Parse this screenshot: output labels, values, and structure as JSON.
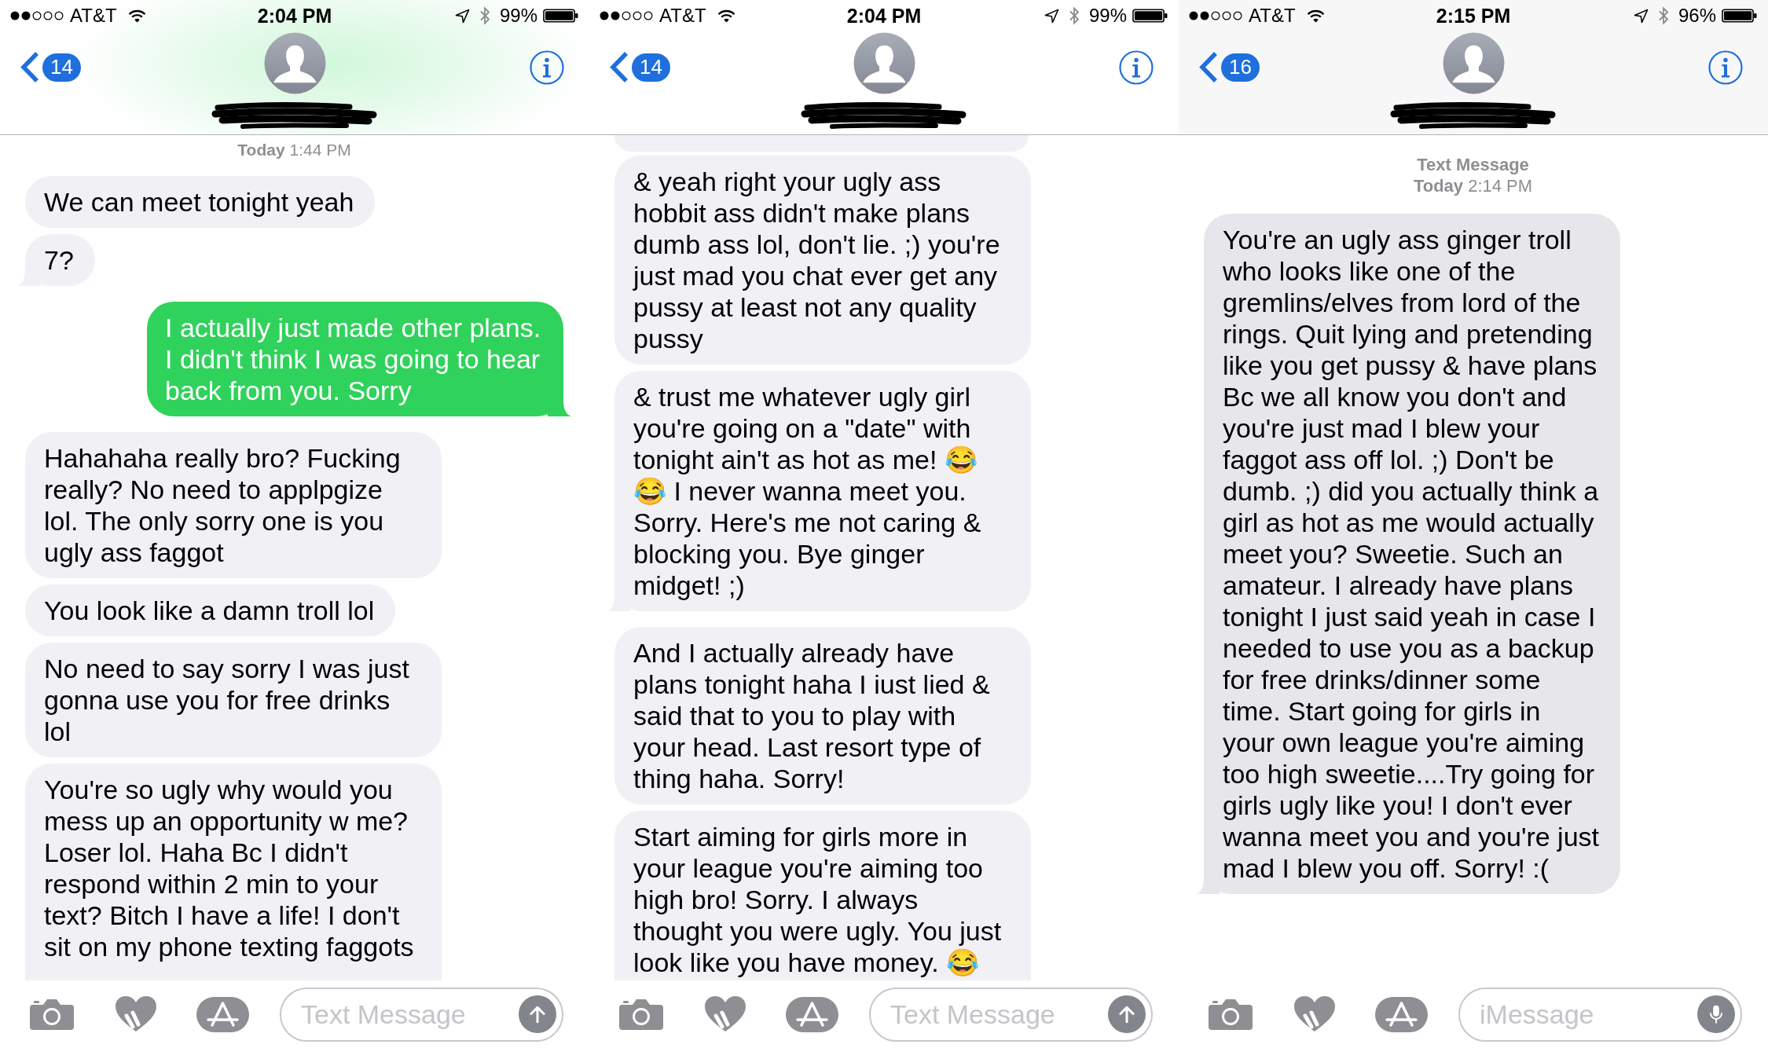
{
  "panels": [
    {
      "status_bar": {
        "carrier": "AT&T",
        "time": "2:04 PM",
        "battery": "99%"
      },
      "nav": {
        "back_count": "14",
        "name_redacted": true
      },
      "header_glow": true,
      "cut_bubble_above": false,
      "timestamp": {
        "time": "**Today** 1:44 PM"
      },
      "messages": [
        {
          "kind": "received",
          "tail": false,
          "continues_below": false,
          "text": "We can meet tonight yeah"
        },
        {
          "kind": "received",
          "tail": true,
          "continues_below": false,
          "text": "7?"
        },
        {
          "kind": "sent",
          "tail": true,
          "continues_below": false,
          "text": "I actually just made other plans. I didn't think I was going to hear back from you. Sorry"
        },
        {
          "kind": "received",
          "tail": false,
          "continues_below": false,
          "text": "Hahahaha really bro? Fucking really? No need to applpgize lol. The only sorry one is you ugly ass faggot"
        },
        {
          "kind": "received",
          "tail": false,
          "continues_below": false,
          "text": "You look like a damn troll lol"
        },
        {
          "kind": "received",
          "tail": false,
          "continues_below": false,
          "text": "No need to say sorry I was just gonna use you for free drinks lol"
        },
        {
          "kind": "received",
          "tail": false,
          "continues_below": true,
          "text": "You're so ugly why would you mess up an opportunity w me? Loser lol. Haha Bc I didn't respond within 2 min to your text? Bitch I have a life! I don't sit on my phone texting faggots"
        }
      ],
      "composer": {
        "placeholder": "Text Message",
        "kind": "send"
      }
    },
    {
      "status_bar": {
        "carrier": "AT&T",
        "time": "2:04 PM",
        "battery": "99%"
      },
      "nav": {
        "back_count": "14",
        "name_redacted": true
      },
      "header_glow": false,
      "cut_bubble_above": true,
      "messages": [
        {
          "kind": "received",
          "tail": false,
          "continues_below": false,
          "text": "& yeah right your ugly ass hobbit ass didn't make plans dumb ass lol, don't lie. ;) you're just mad you chat ever get any pussy at least not any quality pussy"
        },
        {
          "kind": "received",
          "tail": true,
          "continues_below": false,
          "text": "& trust me whatever ugly girl you're going on a \"date\" with tonight ain't as hot as me! 😂 😂 I never wanna meet you. Sorry. Here's me not caring & blocking you. Bye ginger midget! ;)"
        },
        {
          "kind": "received",
          "tail": false,
          "continues_below": false,
          "text": "And I actually already have plans tonight haha I iust lied & said that to you to play with your head. Last resort type of thing haha. Sorry!"
        },
        {
          "kind": "received",
          "tail": false,
          "continues_below": true,
          "text": "Start aiming for girls more in your league you're aiming too high bro! Sorry. I always thought you were ugly. You just look like you have money. 😂"
        }
      ],
      "composer": {
        "placeholder": "Text Message",
        "kind": "send"
      }
    },
    {
      "status_bar": {
        "carrier": "AT&T",
        "time": "2:15 PM",
        "battery": "96%"
      },
      "nav": {
        "back_count": "16",
        "name_redacted": true
      },
      "header_glow": false,
      "cut_bubble_above": false,
      "timestamp": {
        "service": "Text Message",
        "time": "**Today** 2:14 PM"
      },
      "messages": [
        {
          "kind": "received",
          "tail": true,
          "continues_below": false,
          "text": "You're an ugly ass ginger troll who looks like one of the gremlins/elves from lord of the rings. Quit lying and pretending like you get pussy & have plans Bc we all know you don't and you're just mad I blew your faggot ass off lol. ;) Don't be dumb. ;) did you actually think a girl as hot as me would actually meet you? Sweetie. Such an amateur. I already have plans tonight I just said yeah in case I needed to use you as a backup for free drinks/dinner some time. Start going for girls in your own league you're aiming too high sweetie....Try going for girls ugly like you! I don't ever wanna meet you and you're just mad I blew you off. Sorry! :("
        }
      ],
      "composer": {
        "placeholder": "iMessage",
        "kind": "dictation"
      }
    }
  ]
}
